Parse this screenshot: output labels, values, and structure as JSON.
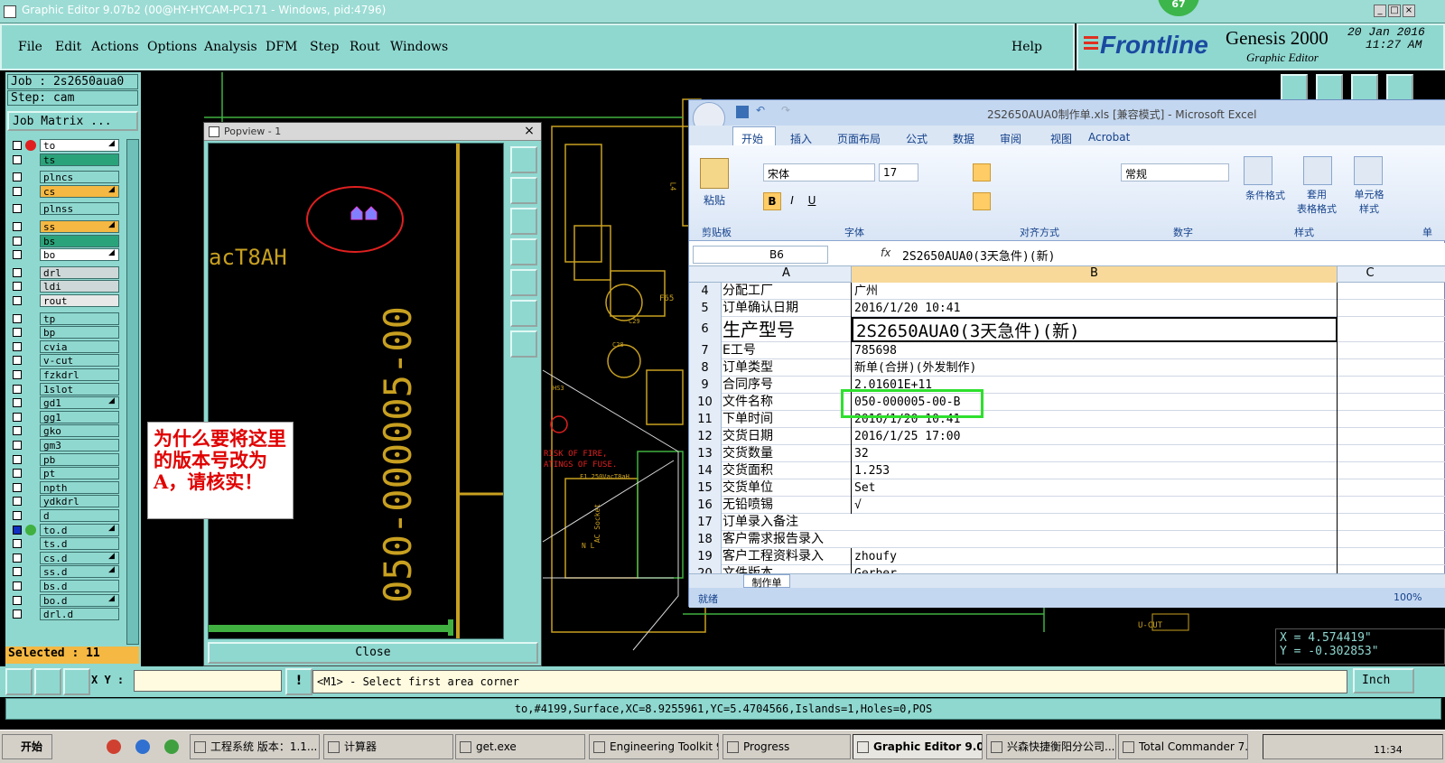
{
  "title": "Graphic Editor 9.07b2 (00@HY-HYCAM-PC171 - Windows, pid:4796)",
  "badge": "67",
  "menu": [
    "File",
    "Edit",
    "Actions",
    "Options",
    "Analysis",
    "DFM",
    "Step",
    "Rout",
    "Windows"
  ],
  "help": "Help",
  "brand": {
    "logo": "Frontline",
    "product": "Genesis 2000",
    "sub": "Graphic Editor",
    "date": "20 Jan 2016",
    "time": "11:27 AM"
  },
  "job": {
    "job": "Job : 2s2650aua0",
    "step": "Step: cam",
    "matrix": "Job Matrix ...",
    "selected": "Selected : 11"
  },
  "layers": [
    {
      "name": "to",
      "color": "#ffffff",
      "arrow": "◢"
    },
    {
      "name": "ts",
      "color": "#2aa37a",
      "arrow": ""
    },
    {
      "name": "plncs",
      "color": "#8fd8d0",
      "arrow": ""
    },
    {
      "name": "cs",
      "color": "#f5b842",
      "arrow": "◢"
    },
    {
      "name": "plnss",
      "color": "#8fd8d0",
      "arrow": ""
    },
    {
      "name": "ss",
      "color": "#f5b842",
      "arrow": "◢"
    },
    {
      "name": "bs",
      "color": "#2aa37a",
      "arrow": ""
    },
    {
      "name": "bo",
      "color": "#ffffff",
      "arrow": "◢"
    },
    {
      "name": "drl",
      "color": "#cfd8d8",
      "arrow": ""
    },
    {
      "name": "ldi",
      "color": "#cfd8d8",
      "arrow": ""
    },
    {
      "name": "rout",
      "color": "#e8e8e8",
      "arrow": ""
    },
    {
      "name": "tp",
      "color": "#8fd8d0",
      "arrow": ""
    },
    {
      "name": "bp",
      "color": "#8fd8d0",
      "arrow": ""
    },
    {
      "name": "cvia",
      "color": "#8fd8d0",
      "arrow": ""
    },
    {
      "name": "v-cut",
      "color": "#8fd8d0",
      "arrow": ""
    },
    {
      "name": "fzkdrl",
      "color": "#8fd8d0",
      "arrow": ""
    },
    {
      "name": "1slot",
      "color": "#8fd8d0",
      "arrow": ""
    },
    {
      "name": "gd1",
      "color": "#8fd8d0",
      "arrow": "◢"
    },
    {
      "name": "gg1",
      "color": "#8fd8d0",
      "arrow": ""
    },
    {
      "name": "gko",
      "color": "#8fd8d0",
      "arrow": ""
    },
    {
      "name": "gm3",
      "color": "#8fd8d0",
      "arrow": ""
    },
    {
      "name": "pb",
      "color": "#8fd8d0",
      "arrow": ""
    },
    {
      "name": "pt",
      "color": "#8fd8d0",
      "arrow": ""
    },
    {
      "name": "npth",
      "color": "#8fd8d0",
      "arrow": ""
    },
    {
      "name": "ydkdrl",
      "color": "#8fd8d0",
      "arrow": ""
    },
    {
      "name": "d",
      "color": "#8fd8d0",
      "arrow": ""
    },
    {
      "name": "to.d",
      "color": "#8fd8d0",
      "arrow": "◢"
    },
    {
      "name": "ts.d",
      "color": "#8fd8d0",
      "arrow": ""
    },
    {
      "name": "cs.d",
      "color": "#8fd8d0",
      "arrow": "◢"
    },
    {
      "name": "ss.d",
      "color": "#8fd8d0",
      "arrow": "◢"
    },
    {
      "name": "bs.d",
      "color": "#8fd8d0",
      "arrow": ""
    },
    {
      "name": "bo.d",
      "color": "#8fd8d0",
      "arrow": "◢"
    },
    {
      "name": "drl.d",
      "color": "#8fd8d0",
      "arrow": ""
    }
  ],
  "popview": {
    "title": "Popview - 1",
    "close": "Close",
    "text_vertical": "050-000005-00",
    "text_fragment": "acT8AH"
  },
  "annotation": "为什么要将这里的版本号改为A，请核实！",
  "canvas_texts": {
    "risk": "RISK OF FIRE,",
    "ratings": "ATINGS OF FUSE.",
    "fuse": "F1 250VacT8aH",
    "vcut": "U-CUT",
    "f65": "F65",
    "l4": "L4",
    "socket": "AC Socket",
    "c29": "C29",
    "c28": "C28",
    "hs3": "HS3",
    "ln": "N L"
  },
  "excel": {
    "title": "2S2650AUA0制作单.xls  [兼容模式] - Microsoft Excel",
    "tabs": [
      "开始",
      "插入",
      "页面布局",
      "公式",
      "数据",
      "审阅",
      "视图",
      "Acrobat"
    ],
    "font": "宋体",
    "size": "17",
    "numfmt": "常规",
    "groups": [
      "剪贴板",
      "字体",
      "对齐方式",
      "数字",
      "样式",
      "单"
    ],
    "paste": "粘贴",
    "style_btns": [
      "条件格式",
      "套用\n表格格式",
      "单元格\n样式"
    ],
    "namebox": "B6",
    "fx": "fx",
    "formula": "2S2650AUA0(3天急件)(新)",
    "cols": [
      "A",
      "B",
      "C"
    ],
    "rows": [
      {
        "n": "4",
        "a": "分配工厂",
        "b": "广州"
      },
      {
        "n": "5",
        "a": "订单确认日期",
        "b": "2016/1/20 10:41"
      },
      {
        "n": "6",
        "a": "生产型号",
        "b": "2S2650AUA0(3天急件)(新)"
      },
      {
        "n": "7",
        "a": "E工号",
        "b": "785698"
      },
      {
        "n": "8",
        "a": "订单类型",
        "b": "新单(合拼)(外发制作)"
      },
      {
        "n": "9",
        "a": "合同序号",
        "b": "  2.01601E+11"
      },
      {
        "n": "10",
        "a": "文件名称",
        "b": "050-000005-00-B"
      },
      {
        "n": "11",
        "a": "下单时间",
        "b": "2016/1/20 10:41"
      },
      {
        "n": "12",
        "a": "交货日期",
        "b": "2016/1/25 17:00"
      },
      {
        "n": "13",
        "a": "交货数量",
        "b": "32"
      },
      {
        "n": "14",
        "a": "交货面积",
        "b": "1.253"
      },
      {
        "n": "15",
        "a": "交货单位",
        "b": "Set"
      },
      {
        "n": "16",
        "a": "无铅喷锡",
        "b": "√"
      },
      {
        "n": "17",
        "a": "订单录入备注",
        "b": ""
      },
      {
        "n": "18",
        "a": "客户需求报告录入",
        "b": ""
      },
      {
        "n": "19",
        "a": "客户工程资料录入",
        "b": "zhoufy"
      },
      {
        "n": "20",
        "a": "文件版本",
        "b": "Gerber"
      }
    ],
    "sheet": "制作单",
    "status": "就绪",
    "zoom": "100%"
  },
  "coords": {
    "x": "X =  4.574419\"",
    "y": "Y = -0.302853\""
  },
  "cmd": {
    "xy": "X Y :",
    "prompt": "<M1> - Select first area corner",
    "units": "Inch"
  },
  "status_line": "to,#4199,Surface,XC=8.9255961,YC=5.4704566,Islands=1,Holes=0,POS",
  "taskbar": {
    "start": "开始",
    "items": [
      "工程系统  版本：1.1...",
      "计算器",
      "get.exe",
      "Engineering Toolkit 9....",
      "Progress",
      "Graphic Editor 9.07b2 ...",
      "兴森快捷衡阳分公司...",
      "Total Commander 7.0 ..."
    ],
    "clock": "11:34"
  }
}
